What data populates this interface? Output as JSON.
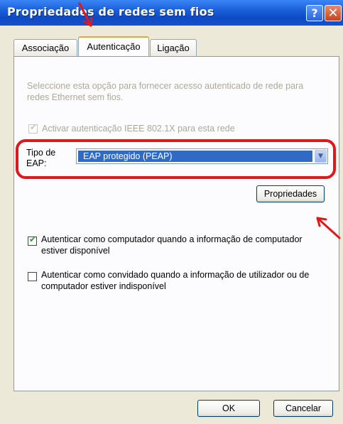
{
  "window": {
    "title": "Propriedades de redes sem fios",
    "help_glyph": "?",
    "close_glyph": "✕"
  },
  "tabs": [
    {
      "label": "Associação"
    },
    {
      "label": "Autenticação",
      "active": true
    },
    {
      "label": "Ligação"
    }
  ],
  "auth": {
    "description": "Seleccione esta opção para fornecer acesso autenticado de rede para redes Ethernet sem fios.",
    "enable_8021x": {
      "label": "Activar autenticação IEEE 802.1X para esta rede",
      "checked": true,
      "disabled": true
    },
    "eap_type": {
      "label": "Tipo de EAP:",
      "value": "EAP protegido (PEAP)"
    },
    "properties_button": "Propriedades",
    "auth_as_computer": {
      "label": "Autenticar como computador quando a informação de computador estiver disponível",
      "checked": true
    },
    "auth_as_guest": {
      "label": "Autenticar como convidado quando a informação de utilizador ou de computador estiver indisponível",
      "checked": false
    }
  },
  "buttons": {
    "ok": "OK",
    "cancel": "Cancelar"
  },
  "annotations": {
    "highlight_color": "#e0181a"
  }
}
